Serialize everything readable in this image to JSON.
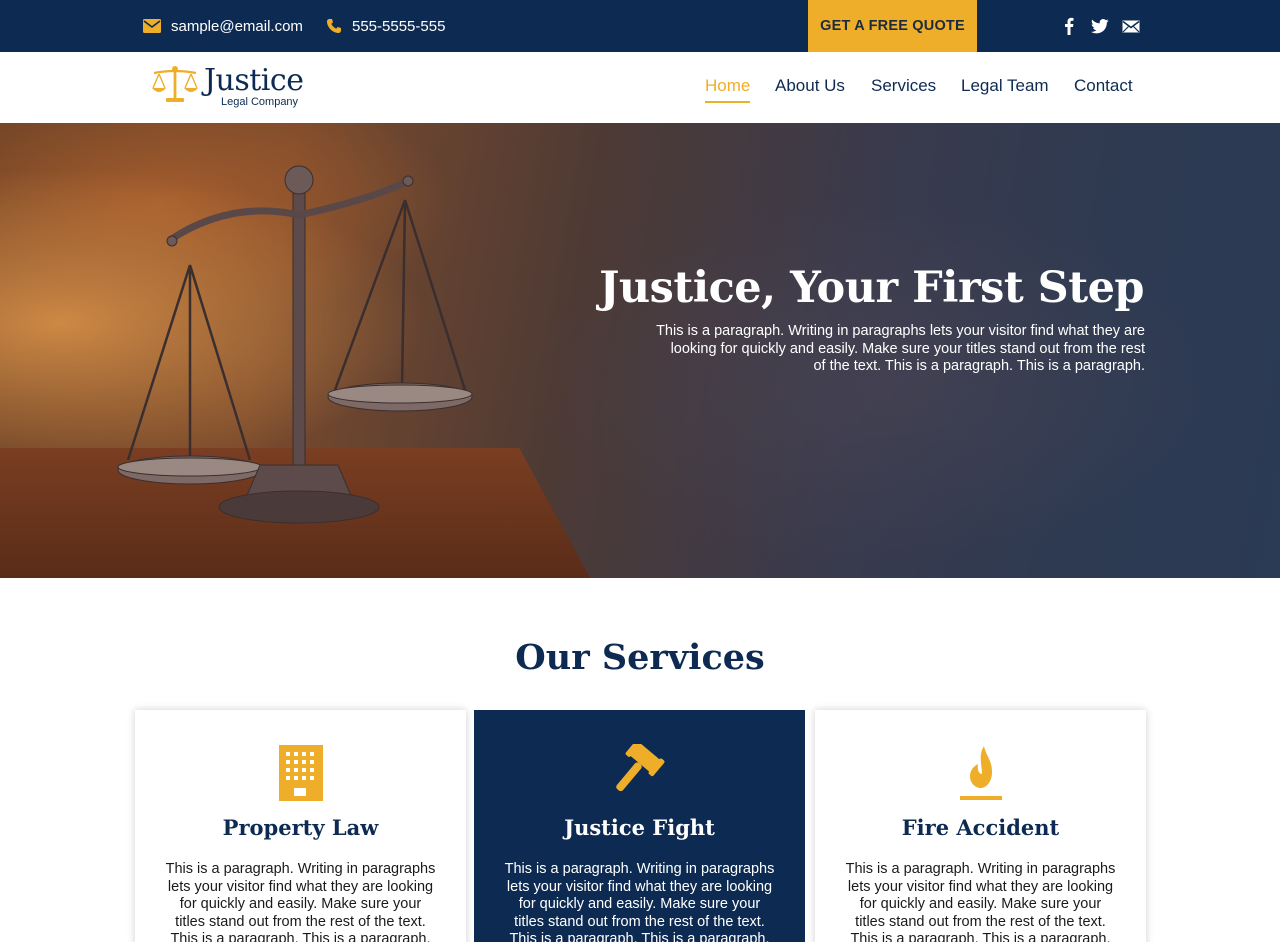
{
  "topbar": {
    "email": "sample@email.com",
    "phone": "555-5555-555",
    "quote_button": "GET A FREE QUOTE",
    "social_icons": [
      "facebook-icon",
      "twitter-icon",
      "mail-icon"
    ]
  },
  "logo": {
    "name": "Justice",
    "tagline": "Legal Company"
  },
  "nav": {
    "items": [
      {
        "label": "Home",
        "active": true
      },
      {
        "label": "About Us",
        "active": false
      },
      {
        "label": "Services",
        "active": false
      },
      {
        "label": "Legal Team",
        "active": false
      },
      {
        "label": "Contact",
        "active": false
      }
    ]
  },
  "hero": {
    "title": "Justice, Your First Step",
    "text": "This is a paragraph. Writing in paragraphs lets your visitor find what they are looking for quickly and easily. Make sure your titles stand out from the rest of the text. This is a paragraph. This is a paragraph."
  },
  "services": {
    "title": "Our Services",
    "cards": [
      {
        "icon": "building-icon",
        "title": "Property Law",
        "text": "This is a paragraph. Writing in paragraphs lets your visitor find what they are looking for quickly and easily. Make sure your titles stand out from the rest of the text. This is a paragraph. This is a paragraph."
      },
      {
        "icon": "gavel-icon",
        "title": "Justice Fight",
        "text": "This is a paragraph. Writing in paragraphs lets your visitor find what they are looking for quickly and easily. Make sure your titles stand out from the rest of the text. This is a paragraph. This is a paragraph."
      },
      {
        "icon": "flame-icon",
        "title": "Fire Accident",
        "text": "This is a paragraph. Writing in paragraphs lets your visitor find what they are looking for quickly and easily. Make sure your titles stand out from the rest of the text. This is a paragraph. This is a paragraph."
      }
    ]
  },
  "colors": {
    "navy": "#0d2b52",
    "gold": "#eeae2a",
    "white": "#ffffff"
  }
}
